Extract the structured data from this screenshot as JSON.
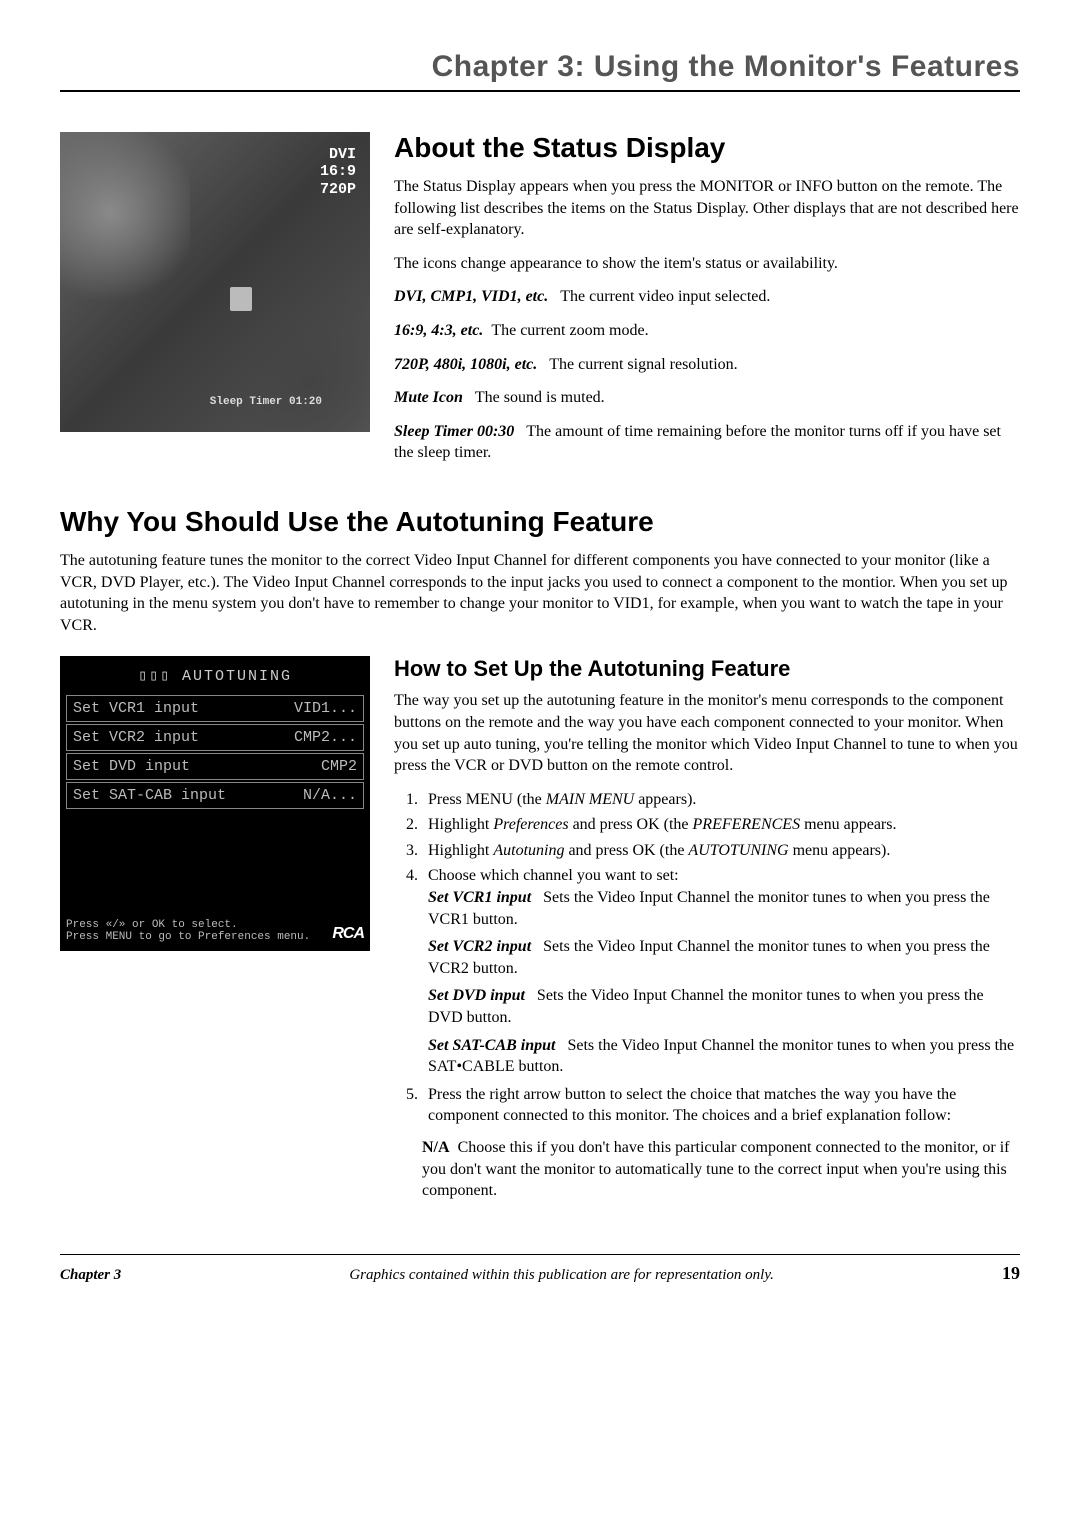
{
  "header": {
    "chapter_title": "Chapter 3: Using the Monitor's Features"
  },
  "status_display_figure": {
    "line1": "DVI",
    "line2": "16:9",
    "line3": "720P",
    "sleep_timer_label": "Sleep Timer 01:20"
  },
  "section1": {
    "heading": "About the Status Display",
    "para1": "The Status Display appears when you press the MONITOR or INFO button on the remote. The following list describes the items on the Status Display. Other displays that are not described here are self-explanatory.",
    "para2": "The icons change appearance to show the item's status or availability.",
    "items": [
      {
        "term": "DVI, CMP1, VID1, etc.",
        "desc": "The current video input selected."
      },
      {
        "term": "16:9, 4:3, etc.",
        "desc": "The current zoom mode."
      },
      {
        "term": "720P, 480i, 1080i, etc.",
        "desc": "The current signal resolution."
      },
      {
        "term": "Mute Icon",
        "desc": "The sound is muted."
      },
      {
        "term": "Sleep Timer 00:30",
        "desc": "The amount of time remaining before the monitor turns off if you have set the sleep timer."
      }
    ]
  },
  "section2": {
    "heading": "Why You Should Use the Autotuning Feature",
    "para": "The autotuning feature tunes the monitor to the correct Video Input Channel for different components you have connected to your monitor (like a VCR, DVD Player, etc.). The Video Input Channel corresponds to the input jacks you used to connect a component to the montior. When you set up autotuning in the menu system you don't have to remember to change your monitor to VID1, for example, when you want to watch the tape in your VCR."
  },
  "autotuning_figure": {
    "title": "AUTOTUNING",
    "rows": [
      {
        "label": "Set VCR1 input",
        "value": "VID1..."
      },
      {
        "label": "Set VCR2 input",
        "value": "CMP2..."
      },
      {
        "label": "Set DVD input",
        "value": "CMP2"
      },
      {
        "label": "Set SAT-CAB input",
        "value": "N/A..."
      }
    ],
    "footer_line1": "Press «/» or OK to select.",
    "footer_line2": "Press MENU to go to Preferences menu.",
    "brand": "RCA"
  },
  "section3": {
    "heading": "How to Set Up the Autotuning Feature",
    "para": "The way you set up the autotuning feature in the monitor's menu corresponds to the component buttons on the remote and the way you have each component connected to your monitor. When you set up auto tuning, you're telling the monitor which Video Input Channel to tune to when you press the VCR or DVD button on the remote control.",
    "steps": {
      "s1_a": "Press MENU (the ",
      "s1_i": "MAIN MENU",
      "s1_b": " appears).",
      "s2_a": "Highlight ",
      "s2_i1": "Preferences",
      "s2_b": " and press OK (the ",
      "s2_i2": "PREFERENCES",
      "s2_c": " menu appears.",
      "s3_a": "Highlight ",
      "s3_i1": "Autotuning",
      "s3_b": " and press OK (the ",
      "s3_i2": "AUTOTUNING",
      "s3_c": " menu appears).",
      "s4": "Choose which channel you want to set:",
      "s5": "Press the right arrow button to select the choice that matches the way you have the component connected to this monitor. The choices and a brief explanation follow:"
    },
    "defs": [
      {
        "term": "Set VCR1 input",
        "desc": "Sets the Video Input Channel the monitor tunes to when you press the VCR1 button."
      },
      {
        "term": "Set VCR2 input",
        "desc": "Sets the Video Input Channel the monitor tunes to when you press the VCR2 button."
      },
      {
        "term": "Set DVD input",
        "desc": "Sets the Video Input Channel the monitor tunes to when you press the DVD button."
      },
      {
        "term": "Set SAT-CAB input",
        "desc": "Sets the Video Input Channel the monitor tunes to when you press the SAT•CABLE button."
      }
    ],
    "na": {
      "term": "N/A",
      "desc": "Choose this if you don't have this particular component connected to the monitor, or if you don't want the monitor to automatically tune to the correct input when you're using this component."
    }
  },
  "footer": {
    "left": "Chapter 3",
    "mid": "Graphics contained within this publication are for representation only.",
    "right": "19"
  }
}
